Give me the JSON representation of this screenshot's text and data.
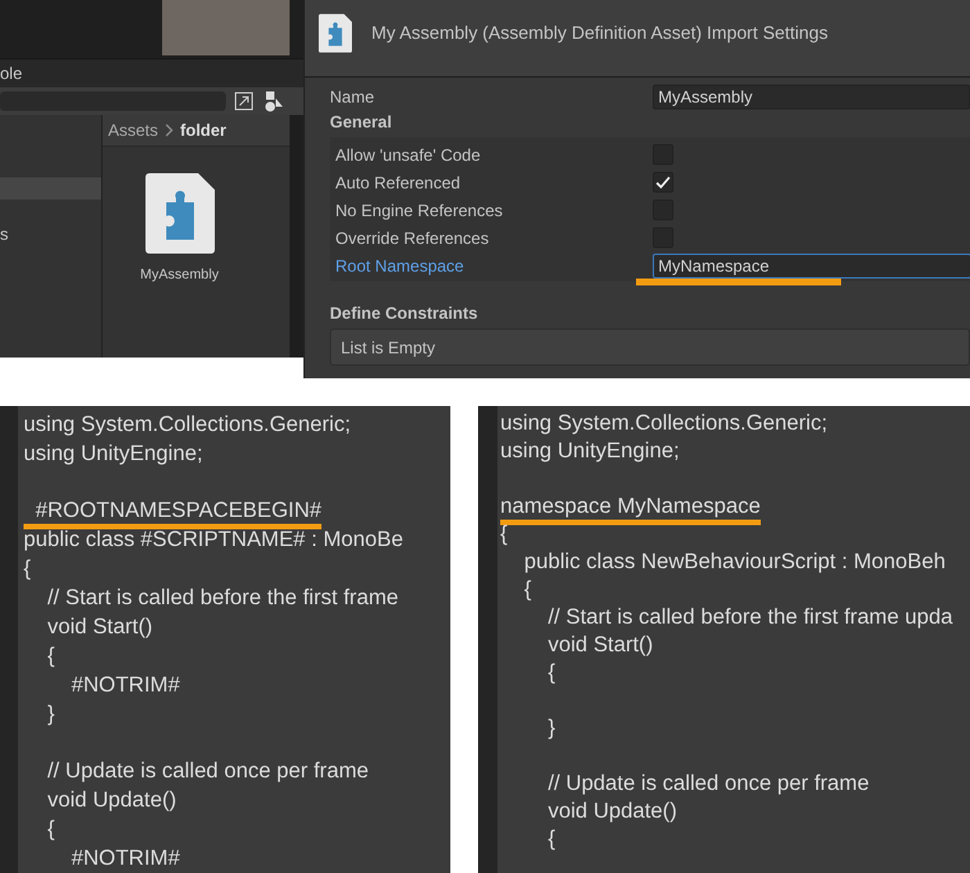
{
  "project_window": {
    "tab_label": "ole",
    "sidebar_items": [
      {
        "selected": true
      },
      {
        "label": "s",
        "selected": false
      }
    ],
    "breadcrumb": [
      "Assets",
      "folder"
    ],
    "assets": [
      {
        "name": "MyAssembly"
      }
    ]
  },
  "inspector": {
    "title": "My Assembly (Assembly Definition Asset) Import Settings",
    "name_field": {
      "label": "Name",
      "value": "MyAssembly"
    },
    "section": "General",
    "rows": [
      {
        "kind": "checkbox",
        "label": "Allow 'unsafe' Code",
        "checked": false
      },
      {
        "kind": "checkbox",
        "label": "Auto Referenced",
        "checked": true
      },
      {
        "kind": "checkbox",
        "label": "No Engine References",
        "checked": false
      },
      {
        "kind": "checkbox",
        "label": "Override References",
        "checked": false
      },
      {
        "kind": "text",
        "label": "Root Namespace",
        "value": "MyNamespace",
        "focused": true,
        "underlined": true
      }
    ],
    "constraints": {
      "heading": "Define Constraints",
      "empty_text": "List is Empty"
    }
  },
  "code_panels": [
    {
      "blocks": [
        [
          {
            "text": "using System.Collections.Generic;",
            "underlined": false
          },
          {
            "text": "using UnityEngine;",
            "underlined": false
          }
        ],
        [
          {
            "text": "  #ROOTNAMESPACEBEGIN#",
            "underlined": true
          },
          {
            "text": "public class #SCRIPTNAME# : MonoBe",
            "underlined": false
          },
          {
            "text": "{",
            "underlined": false
          },
          {
            "text": "    // Start is called before the first frame",
            "underlined": false
          },
          {
            "text": "    void Start()",
            "underlined": false
          },
          {
            "text": "    {",
            "underlined": false
          },
          {
            "text": "        #NOTRIM#",
            "underlined": false
          },
          {
            "text": "    }",
            "underlined": false
          }
        ],
        [
          {
            "text": "    // Update is called once per frame",
            "underlined": false
          },
          {
            "text": "    void Update()",
            "underlined": false
          },
          {
            "text": "    {",
            "underlined": false
          },
          {
            "text": "        #NOTRIM#",
            "underlined": false
          }
        ]
      ]
    },
    {
      "blocks": [
        [
          {
            "text": "using System.Collections.Generic;",
            "underlined": false
          },
          {
            "text": "using UnityEngine;",
            "underlined": false
          }
        ],
        [
          {
            "text": "namespace MyNamespace",
            "underlined": true
          },
          {
            "text": "{",
            "underlined": false
          },
          {
            "text": "    public class NewBehaviourScript : MonoBeh",
            "underlined": false
          },
          {
            "text": "    {",
            "underlined": false
          },
          {
            "text": "        // Start is called before the first frame upda",
            "underlined": false
          },
          {
            "text": "        void Start()",
            "underlined": false
          },
          {
            "text": "        {",
            "underlined": false
          }
        ],
        [
          {
            "text": "        }",
            "underlined": false
          }
        ],
        [
          {
            "text": "        // Update is called once per frame",
            "underlined": false
          },
          {
            "text": "        void Update()",
            "underlined": false
          },
          {
            "text": "        {",
            "underlined": false
          }
        ]
      ]
    }
  ]
}
